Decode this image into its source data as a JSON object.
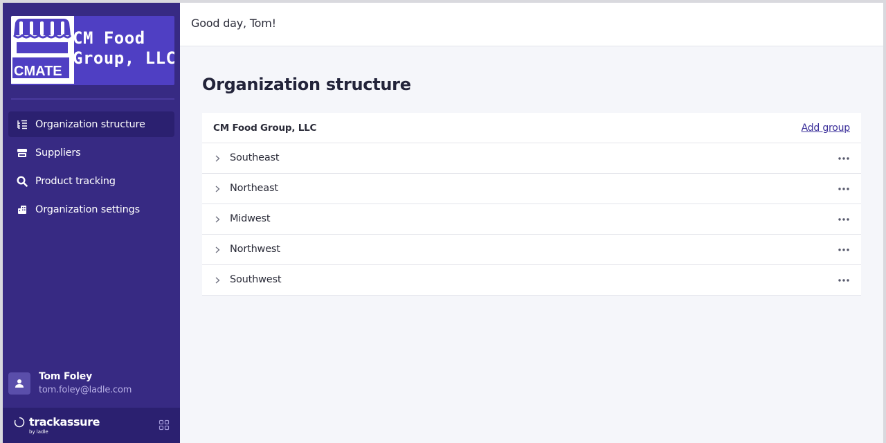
{
  "sidebar": {
    "org_logo": {
      "badge_text": "CMATE",
      "name_line1": "CM Food",
      "name_line2": "Group, LLC"
    },
    "nav": [
      {
        "label": "Organization structure",
        "icon": "org-structure-icon",
        "active": true
      },
      {
        "label": "Suppliers",
        "icon": "storefront-icon",
        "active": false
      },
      {
        "label": "Product tracking",
        "icon": "search-icon",
        "active": false
      },
      {
        "label": "Organization settings",
        "icon": "building-icon",
        "active": false
      }
    ],
    "user": {
      "name": "Tom Foley",
      "email": "tom.foley@ladle.com"
    },
    "brand": {
      "name": "trackassure",
      "by": "by ladle"
    }
  },
  "header": {
    "greeting": "Good day, Tom!"
  },
  "main": {
    "title": "Organization structure",
    "org_name": "CM Food Group, LLC",
    "add_group_label": "Add group",
    "groups": [
      {
        "label": "Southeast"
      },
      {
        "label": "Northeast"
      },
      {
        "label": "Midwest"
      },
      {
        "label": "Northwest"
      },
      {
        "label": "Southwest"
      }
    ]
  },
  "colors": {
    "sidebar_bg": "#372a83",
    "sidebar_active": "#2b2070",
    "logo_bg": "#4f3fc3",
    "accent_link": "#3b2f9a",
    "page_bg": "#f5f6fa"
  }
}
